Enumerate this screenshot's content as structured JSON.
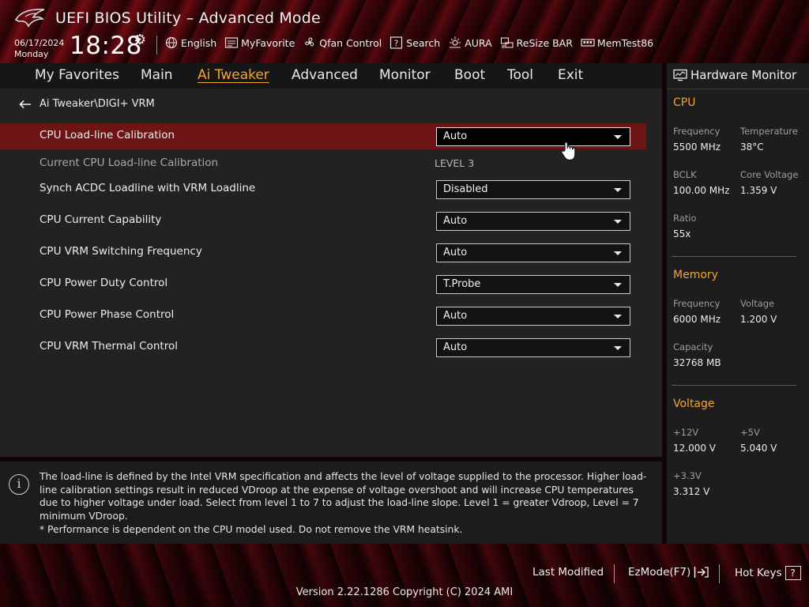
{
  "header": {
    "title": "UEFI BIOS Utility – Advanced Mode",
    "date": "06/17/2024",
    "day": "Monday",
    "time": "18:28"
  },
  "toolbar": [
    {
      "label": "English",
      "icon": "globe-icon"
    },
    {
      "label": "MyFavorite",
      "icon": "favorite-icon"
    },
    {
      "label": "Qfan Control",
      "icon": "fan-icon"
    },
    {
      "label": "Search",
      "icon": "search-icon"
    },
    {
      "label": "AURA",
      "icon": "aura-icon"
    },
    {
      "label": "ReSize BAR",
      "icon": "resize-bar-icon"
    },
    {
      "label": "MemTest86",
      "icon": "memtest-icon"
    }
  ],
  "menu": {
    "items": [
      "My Favorites",
      "Main",
      "Ai Tweaker",
      "Advanced",
      "Monitor",
      "Boot",
      "Tool",
      "Exit"
    ],
    "active": "Ai Tweaker"
  },
  "breadcrumb": "Ai Tweaker\\DIGI+ VRM",
  "settings": [
    {
      "label": "CPU Load-line Calibration",
      "value": "Auto"
    },
    {
      "label": "Current CPU Load-line Calibration",
      "value": "LEVEL 3"
    },
    {
      "label": "Synch ACDC Loadline with VRM Loadline",
      "value": "Disabled"
    },
    {
      "label": "CPU Current Capability",
      "value": "Auto"
    },
    {
      "label": "CPU VRM Switching Frequency",
      "value": "Auto"
    },
    {
      "label": "CPU Power Duty Control",
      "value": "T.Probe"
    },
    {
      "label": "CPU Power Phase Control",
      "value": "Auto"
    },
    {
      "label": "CPU VRM Thermal Control",
      "value": "Auto"
    }
  ],
  "help": {
    "text": "The load-line is defined by the Intel VRM specification and affects the level of voltage supplied to the processor. Higher load-line calibration settings result in reduced VDroop at the expense of voltage overshoot and will increase CPU temperatures due to higher voltage under load. Select from level 1 to 7 to adjust the load-line slope. Level 1 = greater Vdroop, Level = 7 minimum VDroop.",
    "note": "* Performance is dependent on the CPU model used. Do not remove the VRM heatsink."
  },
  "hardware_monitor": {
    "title": "Hardware Monitor",
    "cpu": {
      "section": "CPU",
      "frequency_label": "Frequency",
      "frequency": "5500 MHz",
      "temperature_label": "Temperature",
      "temperature": "38°C",
      "bclk_label": "BCLK",
      "bclk": "100.00 MHz",
      "core_voltage_label": "Core Voltage",
      "core_voltage": "1.359 V",
      "ratio_label": "Ratio",
      "ratio": "55x"
    },
    "memory": {
      "section": "Memory",
      "frequency_label": "Frequency",
      "frequency": "6000 MHz",
      "voltage_label": "Voltage",
      "voltage": "1.200 V",
      "capacity_label": "Capacity",
      "capacity": "32768 MB"
    },
    "voltage": {
      "section": "Voltage",
      "v12_label": "+12V",
      "v12": "12.000 V",
      "v5_label": "+5V",
      "v5": "5.040 V",
      "v33_label": "+3.3V",
      "v33": "3.312 V"
    }
  },
  "footer": {
    "last_modified": "Last Modified",
    "ezmode": "EzMode(F7)",
    "hotkeys": "Hot Keys",
    "hotkeys_key": "?",
    "version": "Version 2.22.1286 Copyright (C) 2024 AMI"
  },
  "colors": {
    "accent": "#f4a532",
    "highlight_row": "#6d1515"
  }
}
